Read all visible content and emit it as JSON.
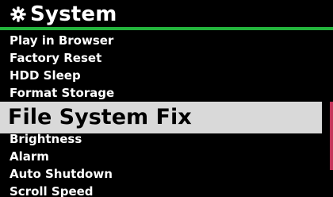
{
  "header": {
    "title": "System",
    "icon": "gear-icon"
  },
  "menu": {
    "items": [
      {
        "label": "Play in Browser",
        "selected": false
      },
      {
        "label": "Factory Reset",
        "selected": false
      },
      {
        "label": "HDD Sleep",
        "selected": false
      },
      {
        "label": "Format Storage",
        "selected": false
      },
      {
        "label": "File System Fix",
        "selected": true
      },
      {
        "label": "Brightness",
        "selected": false
      },
      {
        "label": "Alarm",
        "selected": false
      },
      {
        "label": "Auto Shutdown",
        "selected": false
      },
      {
        "label": "Scroll Speed",
        "selected": false
      }
    ]
  },
  "colors": {
    "background": "#000000",
    "header_rule": "#23b43c",
    "selection_background": "#d9d9d9",
    "scroll_thumb": "#c4345a"
  }
}
